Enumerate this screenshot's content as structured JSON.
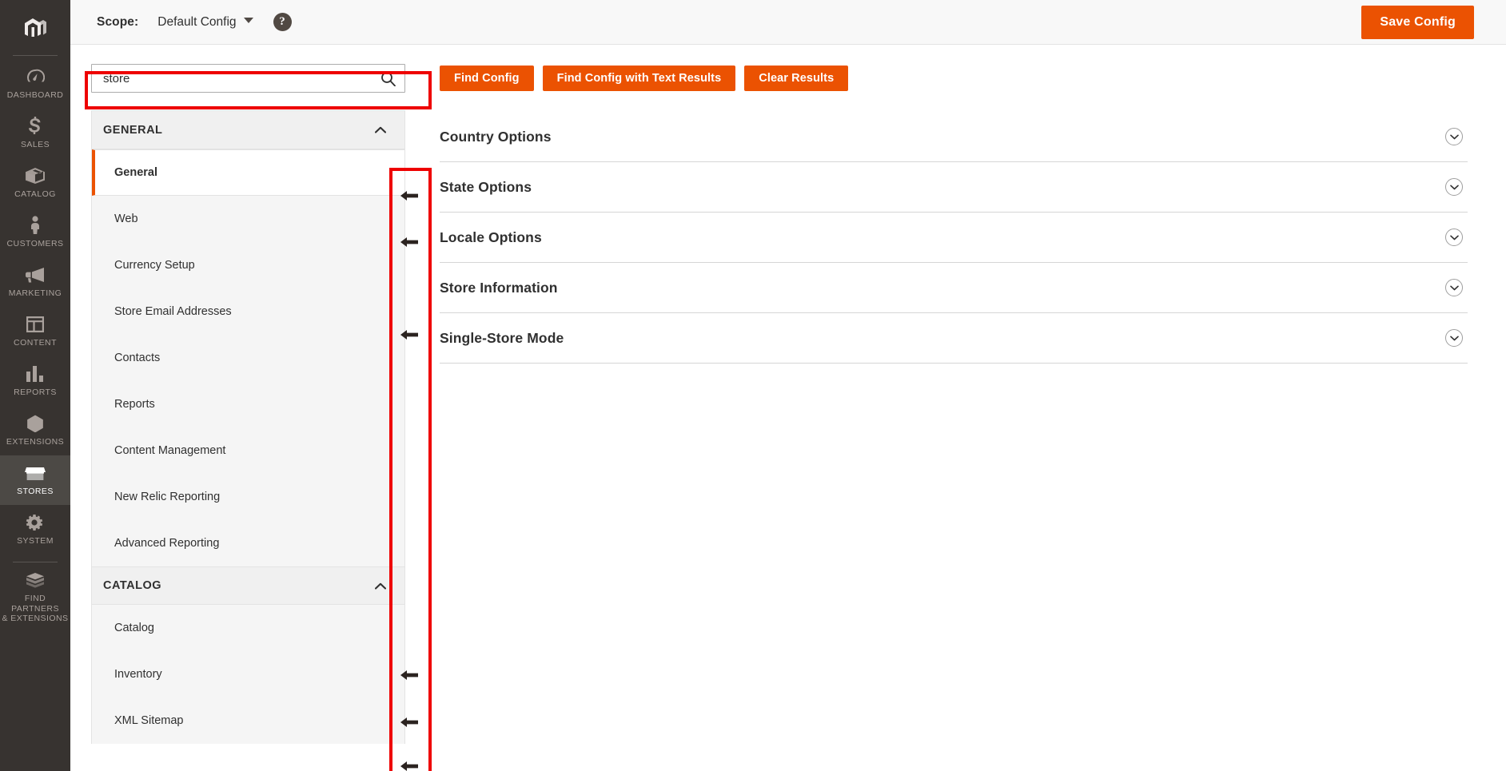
{
  "admin_nav": {
    "logo": "magento-logo-icon",
    "items": [
      {
        "label": "DASHBOARD",
        "icon": "dashboard-gauge-icon",
        "active": false
      },
      {
        "label": "SALES",
        "icon": "dollar-sign-icon",
        "active": false
      },
      {
        "label": "CATALOG",
        "icon": "box-icon",
        "active": false
      },
      {
        "label": "CUSTOMERS",
        "icon": "person-icon",
        "active": false
      },
      {
        "label": "MARKETING",
        "icon": "megaphone-icon",
        "active": false
      },
      {
        "label": "CONTENT",
        "icon": "layout-page-icon",
        "active": false
      },
      {
        "label": "REPORTS",
        "icon": "bar-chart-icon",
        "active": false
      },
      {
        "label": "EXTENSIONS",
        "icon": "hexagon-icon",
        "active": false
      },
      {
        "label": "STORES",
        "icon": "storefront-icon",
        "active": true
      },
      {
        "label": "SYSTEM",
        "icon": "gear-icon",
        "active": false
      },
      {
        "label": "FIND PARTNERS\n& EXTENSIONS",
        "icon": "blocks-icon",
        "active": false
      }
    ]
  },
  "header": {
    "scope_label": "Scope:",
    "scope_value": "Default Config",
    "help_icon": "question-mark-icon",
    "save_label": "Save Config"
  },
  "search": {
    "value": "store",
    "placeholder": "Search",
    "icon": "search-icon"
  },
  "actions": [
    {
      "label": "Find Config"
    },
    {
      "label": "Find Config with Text Results"
    },
    {
      "label": "Clear Results"
    }
  ],
  "config_menu": {
    "sections": [
      {
        "title": "GENERAL",
        "collapse_icon": "chevron-up-icon",
        "items": [
          {
            "label": "General",
            "active": true,
            "arrow": true
          },
          {
            "label": "Web",
            "active": false,
            "arrow": true
          },
          {
            "label": "Currency Setup",
            "active": false,
            "arrow": false
          },
          {
            "label": "Store Email Addresses",
            "active": false,
            "arrow": true
          },
          {
            "label": "Contacts",
            "active": false,
            "arrow": false
          },
          {
            "label": "Reports",
            "active": false,
            "arrow": false
          },
          {
            "label": "Content Management",
            "active": false,
            "arrow": false
          },
          {
            "label": "New Relic Reporting",
            "active": false,
            "arrow": false
          },
          {
            "label": "Advanced Reporting",
            "active": false,
            "arrow": false
          }
        ]
      },
      {
        "title": "CATALOG",
        "collapse_icon": "chevron-up-icon",
        "items": [
          {
            "label": "Catalog",
            "active": false,
            "arrow": true
          },
          {
            "label": "Inventory",
            "active": false,
            "arrow": true
          },
          {
            "label": "XML Sitemap",
            "active": false,
            "arrow": true
          }
        ]
      }
    ]
  },
  "content_panels": [
    {
      "title": "Country Options",
      "expand_icon": "chevron-down-circle-icon"
    },
    {
      "title": "State Options",
      "expand_icon": "chevron-down-circle-icon"
    },
    {
      "title": "Locale Options",
      "expand_icon": "chevron-down-circle-icon"
    },
    {
      "title": "Store Information",
      "expand_icon": "chevron-down-circle-icon"
    },
    {
      "title": "Single-Store Mode",
      "expand_icon": "chevron-down-circle-icon"
    }
  ],
  "annotations": {
    "search_highlight": "red-rectangle-highlight",
    "arrow_column_highlight": "red-rectangle-highlight",
    "arrows": "left-pointing-arrow"
  },
  "colors": {
    "accent_orange": "#eb5202",
    "nav_dark": "#373330",
    "nav_active": "#4c4945",
    "annotation_red": "#ee0000",
    "text_dark": "#303030"
  }
}
